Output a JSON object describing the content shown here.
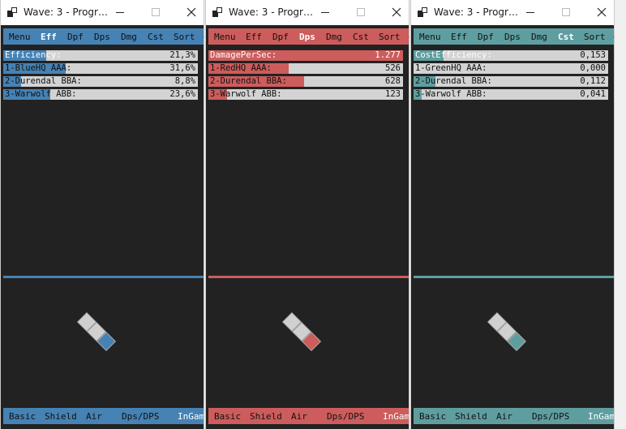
{
  "windows": [
    {
      "title": "Wave: 3 - Progr…",
      "accent": "#4682b4",
      "menu": [
        "Menu",
        "Eff",
        "Dpf",
        "Dps",
        "Dmg",
        "Cst",
        "Sort",
        "<"
      ],
      "active_menu": "Eff",
      "header": {
        "label": "Efficiency:",
        "value": "21,3%",
        "fill": 0.22
      },
      "rows": [
        {
          "label": "1-BlueHQ AAA:",
          "value": "31,6%",
          "fill": 0.32
        },
        {
          "label": "2-Durendal BBA:",
          "value": "8,8%",
          "fill": 0.09
        },
        {
          "label": "3-Warwolf ABB:",
          "value": "23,6%",
          "fill": 0.24
        }
      ],
      "bottom": [
        "Basic",
        "Shield",
        "Air",
        "Dps/DPS",
        "InGame"
      ],
      "bottom_active": "InGame"
    },
    {
      "title": "Wave: 3 - Progr…",
      "accent": "#cd5c5c",
      "menu": [
        "Menu",
        "Eff",
        "Dpf",
        "Dps",
        "Dmg",
        "Cst",
        "Sort",
        "<"
      ],
      "active_menu": "Dps",
      "header": {
        "label": "DamagePerSec:",
        "value": "1.277",
        "fill": 1.0
      },
      "rows": [
        {
          "label": "1-RedHQ AAA:",
          "value": "526",
          "fill": 0.412
        },
        {
          "label": "2-Durendal BBA:",
          "value": "628",
          "fill": 0.492
        },
        {
          "label": "3-Warwolf ABB:",
          "value": "123",
          "fill": 0.096
        }
      ],
      "bottom": [
        "Basic",
        "Shield",
        "Air",
        "Dps/DPS",
        "InGame"
      ],
      "bottom_active": "InGame"
    },
    {
      "title": "Wave: 3 - Progr…",
      "accent": "#5f9ea0",
      "menu": [
        "Menu",
        "Eff",
        "Dpf",
        "Dps",
        "Dmg",
        "Cst",
        "Sort",
        "<"
      ],
      "active_menu": "Cst",
      "header": {
        "label": "CostEfficiency:",
        "value": "0,153",
        "fill": 0.153
      },
      "rows": [
        {
          "label": "1-GreenHQ AAA:",
          "value": "0,000",
          "fill": 0.0
        },
        {
          "label": "2-Durendal BBA:",
          "value": "0,112",
          "fill": 0.112
        },
        {
          "label": "3-Warwolf ABB:",
          "value": "0,041",
          "fill": 0.041
        }
      ],
      "bottom": [
        "Basic",
        "Shield",
        "Air",
        "Dps/DPS",
        "InGame"
      ],
      "bottom_active": "InGame"
    }
  ]
}
